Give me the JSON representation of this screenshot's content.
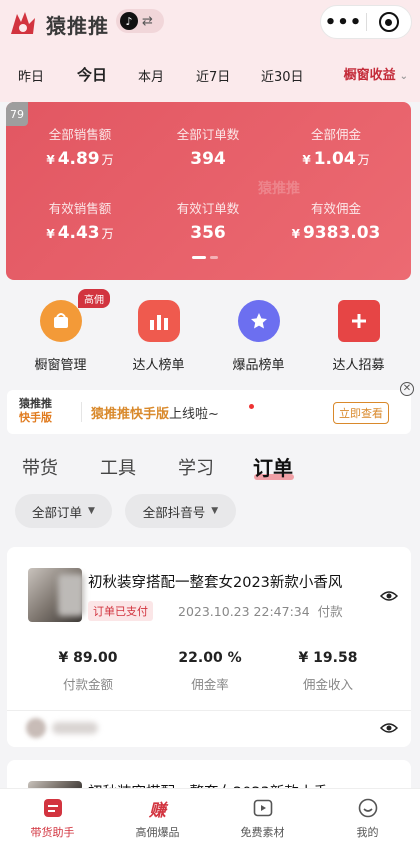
{
  "header": {
    "app_title": "猿推推",
    "account_icon": "tiktok-icon",
    "switch_icon": "swap-icon",
    "more_icon": "more-icon",
    "close_icon": "target-close-icon"
  },
  "date_tabs": [
    {
      "label": "昨日",
      "active": false
    },
    {
      "label": "今日",
      "active": true
    },
    {
      "label": "本月",
      "active": false
    },
    {
      "label": "近7日",
      "active": false
    },
    {
      "label": "近30日",
      "active": false
    }
  ],
  "metric_select": {
    "label": "橱窗收益"
  },
  "corner_badge": "79",
  "stats": [
    {
      "label": "全部销售额",
      "currency": "¥",
      "value": "4.89",
      "unit": "万"
    },
    {
      "label": "全部订单数",
      "currency": "",
      "value": "394",
      "unit": ""
    },
    {
      "label": "全部佣金",
      "currency": "¥",
      "value": "1.04",
      "unit": "万"
    },
    {
      "label": "有效销售额",
      "currency": "¥",
      "value": "4.43",
      "unit": "万"
    },
    {
      "label": "有效订单数",
      "currency": "",
      "value": "356",
      "unit": ""
    },
    {
      "label": "有效佣金",
      "currency": "¥",
      "value": "9383.03",
      "unit": ""
    }
  ],
  "watermark": "猿推推",
  "features": [
    {
      "label": "橱窗管理",
      "icon": "shopping-bag-icon",
      "color": "#f39a38",
      "tag": "高佣"
    },
    {
      "label": "达人榜单",
      "icon": "bar-chart-icon",
      "color": "#ef5a4e"
    },
    {
      "label": "爆品榜单",
      "icon": "medal-star-icon",
      "color": "#6c6ff0"
    },
    {
      "label": "达人招募",
      "icon": "add-recruit-icon",
      "color": "#e64545"
    }
  ],
  "notice": {
    "logo_main": "猿推推",
    "logo_sub": "快手版",
    "highlight": "猿推推快手版",
    "rest": "上线啦~",
    "button": "立即查看"
  },
  "main_tabs": [
    {
      "label": "带货",
      "active": false
    },
    {
      "label": "工具",
      "active": false
    },
    {
      "label": "学习",
      "active": false
    },
    {
      "label": "订单",
      "active": true
    }
  ],
  "filters": [
    {
      "label": "全部订单"
    },
    {
      "label": "全部抖音号"
    }
  ],
  "orders": [
    {
      "title": "初秋装穿搭配一整套女2023新款小香风",
      "status": "订单已支付",
      "time": "2023.10.23 22:47:34",
      "time_suffix": "付款",
      "metrics": [
        {
          "value": "¥ 89.00",
          "label": "付款金额"
        },
        {
          "value": "22.00 %",
          "label": "佣金率"
        },
        {
          "value": "¥ 19.58",
          "label": "佣金收入"
        }
      ]
    },
    {
      "title": "初秋装穿搭配一整套女2023新款小香"
    }
  ],
  "bottom_nav": [
    {
      "label": "带货助手",
      "icon": "assistant-icon",
      "active": true
    },
    {
      "label": "高佣爆品",
      "icon": "earn-icon",
      "glyph": "赚",
      "active": false
    },
    {
      "label": "免费素材",
      "icon": "play-video-icon",
      "active": false
    },
    {
      "label": "我的",
      "icon": "smile-face-icon",
      "active": false
    }
  ],
  "colors": {
    "brand_red": "#d2343f",
    "accent_orange": "#d9892b",
    "card_gradient_start": "#e25762"
  }
}
